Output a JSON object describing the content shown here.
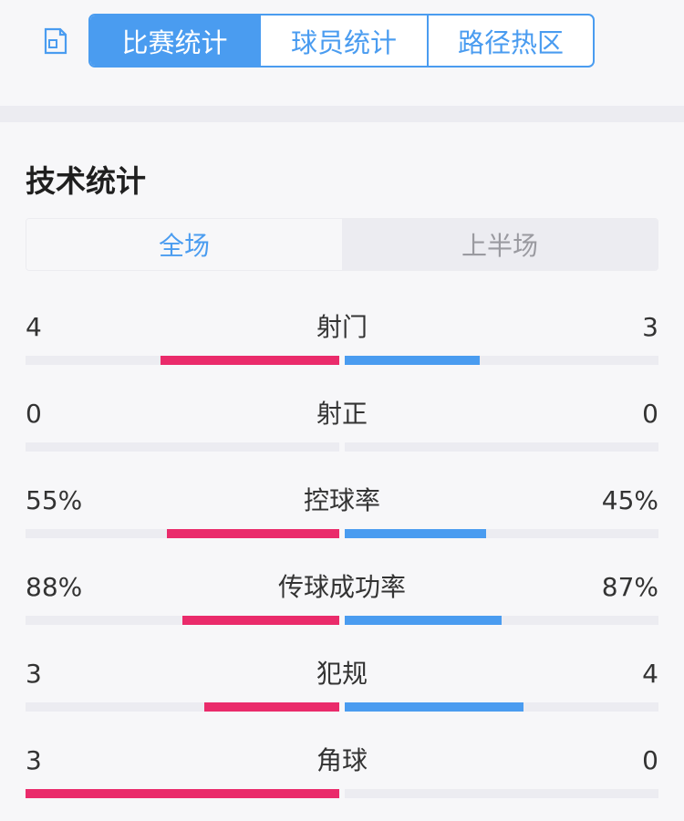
{
  "tabs": [
    {
      "label": "比赛统计",
      "active": true
    },
    {
      "label": "球员统计",
      "active": false
    },
    {
      "label": "路径热区",
      "active": false
    }
  ],
  "section_title": "技术统计",
  "segments": [
    {
      "label": "全场",
      "active": true
    },
    {
      "label": "上半场",
      "active": false
    }
  ],
  "colors": {
    "accent": "#4a9cf0",
    "home_bar": "#ea2b6b",
    "away_bar": "#4a9cf0",
    "track": "#ececf1"
  },
  "stats": [
    {
      "name": "射门",
      "home": "4",
      "away": "3",
      "home_share": 0.57,
      "away_share": 0.43
    },
    {
      "name": "射正",
      "home": "0",
      "away": "0",
      "home_share": 0,
      "away_share": 0
    },
    {
      "name": "控球率",
      "home": "55%",
      "away": "45%",
      "home_share": 0.55,
      "away_share": 0.45
    },
    {
      "name": "传球成功率",
      "home": "88%",
      "away": "87%",
      "home_share": 0.5,
      "away_share": 0.5
    },
    {
      "name": "犯规",
      "home": "3",
      "away": "4",
      "home_share": 0.43,
      "away_share": 0.57
    },
    {
      "name": "角球",
      "home": "3",
      "away": "0",
      "home_share": 1,
      "away_share": 0
    }
  ]
}
